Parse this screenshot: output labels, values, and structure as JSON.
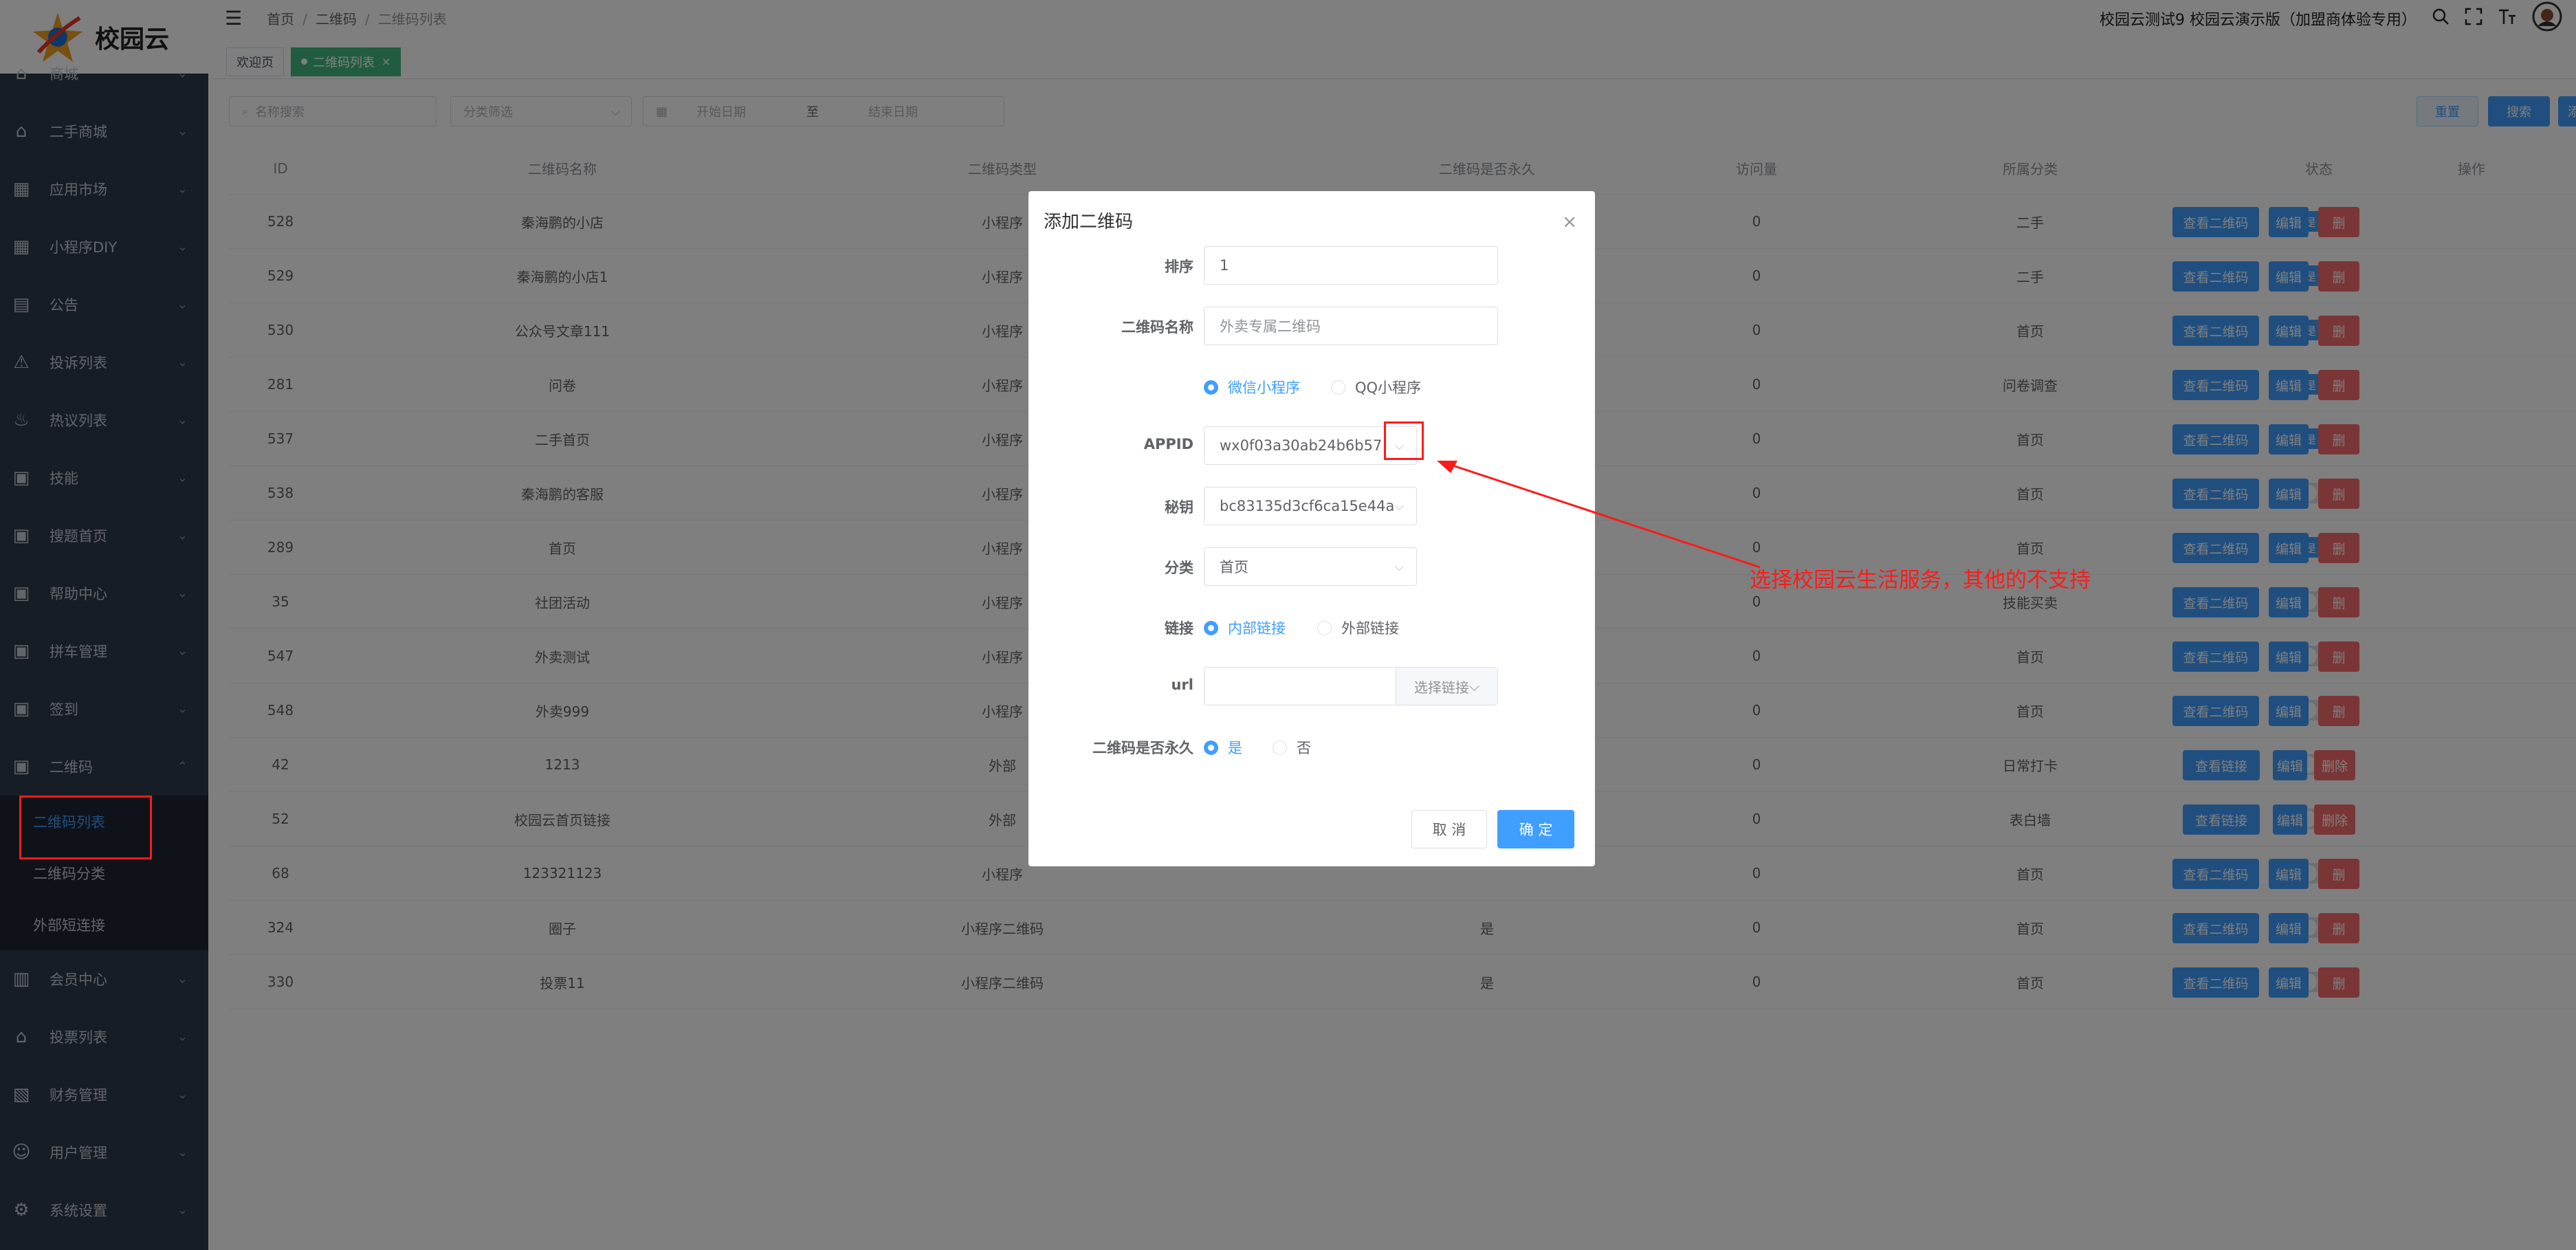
{
  "app": {
    "logo_text": "校园云"
  },
  "header": {
    "breadcrumb": [
      "首页",
      "二维码",
      "二维码列表"
    ],
    "account_title": "校园云测试9 校园云演示版（加盟商体验专用）"
  },
  "tags": [
    {
      "label": "欢迎页"
    },
    {
      "label": "二维码列表",
      "close": "×"
    }
  ],
  "sidebar": {
    "items": [
      {
        "label": "商城",
        "icon": "shop-icon"
      },
      {
        "label": "二手商城",
        "icon": "shop-icon"
      },
      {
        "label": "应用市场",
        "icon": "grid-icon"
      },
      {
        "label": "小程序DIY",
        "icon": "grid-icon"
      },
      {
        "label": "公告",
        "icon": "briefcase-icon"
      },
      {
        "label": "投诉列表",
        "icon": "warning-icon"
      },
      {
        "label": "热议列表",
        "icon": "fire-icon"
      },
      {
        "label": "技能",
        "icon": "card-icon"
      },
      {
        "label": "搜题首页",
        "icon": "card-icon"
      },
      {
        "label": "帮助中心",
        "icon": "card-icon"
      },
      {
        "label": "拼车管理",
        "icon": "card-icon"
      },
      {
        "label": "签到",
        "icon": "card-icon"
      },
      {
        "label": "二维码",
        "icon": "card-icon"
      }
    ],
    "sub_items": [
      {
        "label": "二维码列表"
      },
      {
        "label": "二维码分类"
      },
      {
        "label": "外部短连接"
      }
    ],
    "items_after": [
      {
        "label": "会员中心",
        "icon": "book-icon"
      },
      {
        "label": "投票列表",
        "icon": "shop-icon"
      },
      {
        "label": "财务管理",
        "icon": "wallet-icon"
      },
      {
        "label": "用户管理",
        "icon": "user-icon"
      },
      {
        "label": "系统设置",
        "icon": "gear-icon"
      }
    ]
  },
  "filters": {
    "name_placeholder": "名称搜索",
    "category_placeholder": "分类筛选",
    "start_date": "开始日期",
    "to": "至",
    "end_date": "结束日期",
    "reset": "重置",
    "search": "搜索",
    "add": "添"
  },
  "table": {
    "columns": [
      "ID",
      "二维码名称",
      "二维码类型",
      "二维码是否永久",
      "访问量",
      "所属分类",
      "状态",
      "操作"
    ],
    "rows": [
      {
        "id": "528",
        "name": "秦海鹏的小店",
        "type": "小程序",
        "permanent": "",
        "visits": "0",
        "category": "二手",
        "status": true,
        "actions": [
          "查看二维码",
          "编辑",
          "删"
        ]
      },
      {
        "id": "529",
        "name": "秦海鹏的小店1",
        "type": "小程序",
        "permanent": "",
        "visits": "0",
        "category": "二手",
        "status": true,
        "actions": [
          "查看二维码",
          "编辑",
          "删"
        ]
      },
      {
        "id": "530",
        "name": "公众号文章111",
        "type": "小程序",
        "permanent": "",
        "visits": "0",
        "category": "首页",
        "status": true,
        "actions": [
          "查看二维码",
          "编辑",
          "删"
        ]
      },
      {
        "id": "281",
        "name": "问卷",
        "type": "小程序",
        "permanent": "",
        "visits": "0",
        "category": "问卷调查",
        "status": true,
        "actions": [
          "查看二维码",
          "编辑",
          "删"
        ]
      },
      {
        "id": "537",
        "name": "二手首页",
        "type": "小程序",
        "permanent": "",
        "visits": "0",
        "category": "首页",
        "status": true,
        "actions": [
          "查看二维码",
          "编辑",
          "删"
        ]
      },
      {
        "id": "538",
        "name": "秦海鹏的客服",
        "type": "小程序",
        "permanent": "",
        "visits": "0",
        "category": "首页",
        "status": false,
        "actions": [
          "查看二维码",
          "编辑",
          "删"
        ]
      },
      {
        "id": "289",
        "name": "首页",
        "type": "小程序",
        "permanent": "",
        "visits": "0",
        "category": "首页",
        "status": true,
        "actions": [
          "查看二维码",
          "编辑",
          "删"
        ]
      },
      {
        "id": "35",
        "name": "社团活动",
        "type": "小程序",
        "permanent": "",
        "visits": "0",
        "category": "技能买卖",
        "status": false,
        "actions": [
          "查看二维码",
          "编辑",
          "删"
        ]
      },
      {
        "id": "547",
        "name": "外卖测试",
        "type": "小程序",
        "permanent": "",
        "visits": "0",
        "category": "首页",
        "status": false,
        "actions": [
          "查看二维码",
          "编辑",
          "删"
        ]
      },
      {
        "id": "548",
        "name": "外卖999",
        "type": "小程序",
        "permanent": "",
        "visits": "0",
        "category": "首页",
        "status": false,
        "actions": [
          "查看二维码",
          "编辑",
          "删"
        ]
      },
      {
        "id": "42",
        "name": "1213",
        "type": "外部",
        "permanent": "",
        "visits": "0",
        "category": "日常打卡",
        "status": false,
        "actions": [
          "查看链接",
          "编辑",
          "删除"
        ]
      },
      {
        "id": "52",
        "name": "校园云首页链接",
        "type": "外部",
        "permanent": "",
        "visits": "0",
        "category": "表白墙",
        "status": false,
        "actions": [
          "查看链接",
          "编辑",
          "删除"
        ]
      },
      {
        "id": "68",
        "name": "123321123",
        "type": "小程序",
        "permanent": "",
        "visits": "0",
        "category": "首页",
        "status": false,
        "actions": [
          "查看二维码",
          "编辑",
          "删"
        ]
      },
      {
        "id": "324",
        "name": "圈子",
        "type": "小程序二维码",
        "permanent": "是",
        "visits": "0",
        "category": "首页",
        "status": false,
        "actions": [
          "查看二维码",
          "编辑",
          "删"
        ]
      },
      {
        "id": "330",
        "name": "投票11",
        "type": "小程序二维码",
        "permanent": "是",
        "visits": "0",
        "category": "首页",
        "status": false,
        "actions": [
          "查看二维码",
          "编辑",
          "删"
        ]
      }
    ],
    "status_on_text": "是"
  },
  "dialog": {
    "title": "添加二维码",
    "close": "×",
    "fields": {
      "sort_label": "排序",
      "sort_value": "1",
      "name_label": "二维码名称",
      "name_value": "外卖专属二维码",
      "platform_options": [
        "微信小程序",
        "QQ小程序"
      ],
      "appid_label": "APPID",
      "appid_value": "wx0f03a30ab24b6b57",
      "secret_label": "秘钥",
      "secret_value": "bc83135d3cf6ca15e44a",
      "category_label": "分类",
      "category_value": "首页",
      "link_label": "链接",
      "link_options": [
        "内部链接",
        "外部链接"
      ],
      "url_label": "url",
      "url_value": "",
      "url_button": "选择链接",
      "permanent_label": "二维码是否永久",
      "permanent_options": [
        "是",
        "否"
      ]
    },
    "cancel": "取 消",
    "confirm": "确 定"
  },
  "annotation": {
    "text": "选择校园云生活服务，其他的不支持",
    "color": "#ff1a1a"
  },
  "colors": {
    "primary": "#409eff",
    "danger": "#f56c6c",
    "sidebar": "#2f3a4a",
    "tag_active": "#42b983"
  }
}
